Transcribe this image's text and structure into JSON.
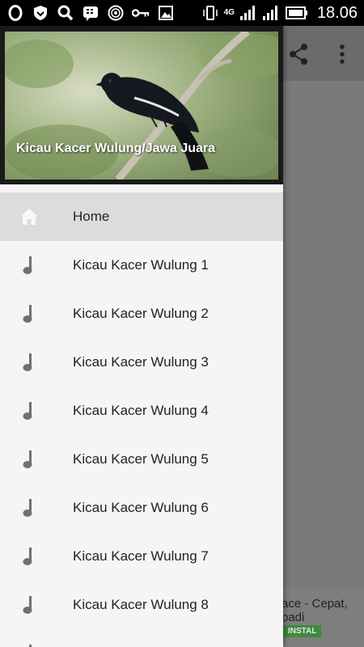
{
  "status_bar": {
    "time": "18.06",
    "network": "4G",
    "icons": [
      "opera-icon",
      "shield-icon",
      "search-icon",
      "bbm-icon",
      "radio-icon",
      "key-icon",
      "image-icon",
      "vibrate-icon",
      "signal-icon",
      "battery-icon"
    ]
  },
  "toolbar": {
    "icons": [
      "share-icon",
      "more-vert-icon"
    ]
  },
  "drawer": {
    "header_title": "Kicau Kacer Wulung/Jawa Juara",
    "items": [
      {
        "label": "Home",
        "icon": "home-icon",
        "active": true
      },
      {
        "label": "Kicau Kacer Wulung 1",
        "icon": "music-note-icon"
      },
      {
        "label": "Kicau Kacer Wulung 2",
        "icon": "music-note-icon"
      },
      {
        "label": "Kicau Kacer Wulung 3",
        "icon": "music-note-icon"
      },
      {
        "label": "Kicau Kacer Wulung 4",
        "icon": "music-note-icon"
      },
      {
        "label": "Kicau Kacer Wulung 5",
        "icon": "music-note-icon"
      },
      {
        "label": "Kicau Kacer Wulung 6",
        "icon": "music-note-icon"
      },
      {
        "label": "Kicau Kacer Wulung 7",
        "icon": "music-note-icon"
      },
      {
        "label": "Kicau Kacer Wulung 8",
        "icon": "music-note-icon"
      }
    ]
  },
  "ad": {
    "text_line1": "ace - Cepat,",
    "text_line2": "padi",
    "button_label": "INSTAL"
  },
  "colors": {
    "drawer_bg": "#f5f5f5",
    "active_item_bg": "#dcdcdc",
    "scrim": "#7a7a7a",
    "icon_gray": "#707070"
  }
}
